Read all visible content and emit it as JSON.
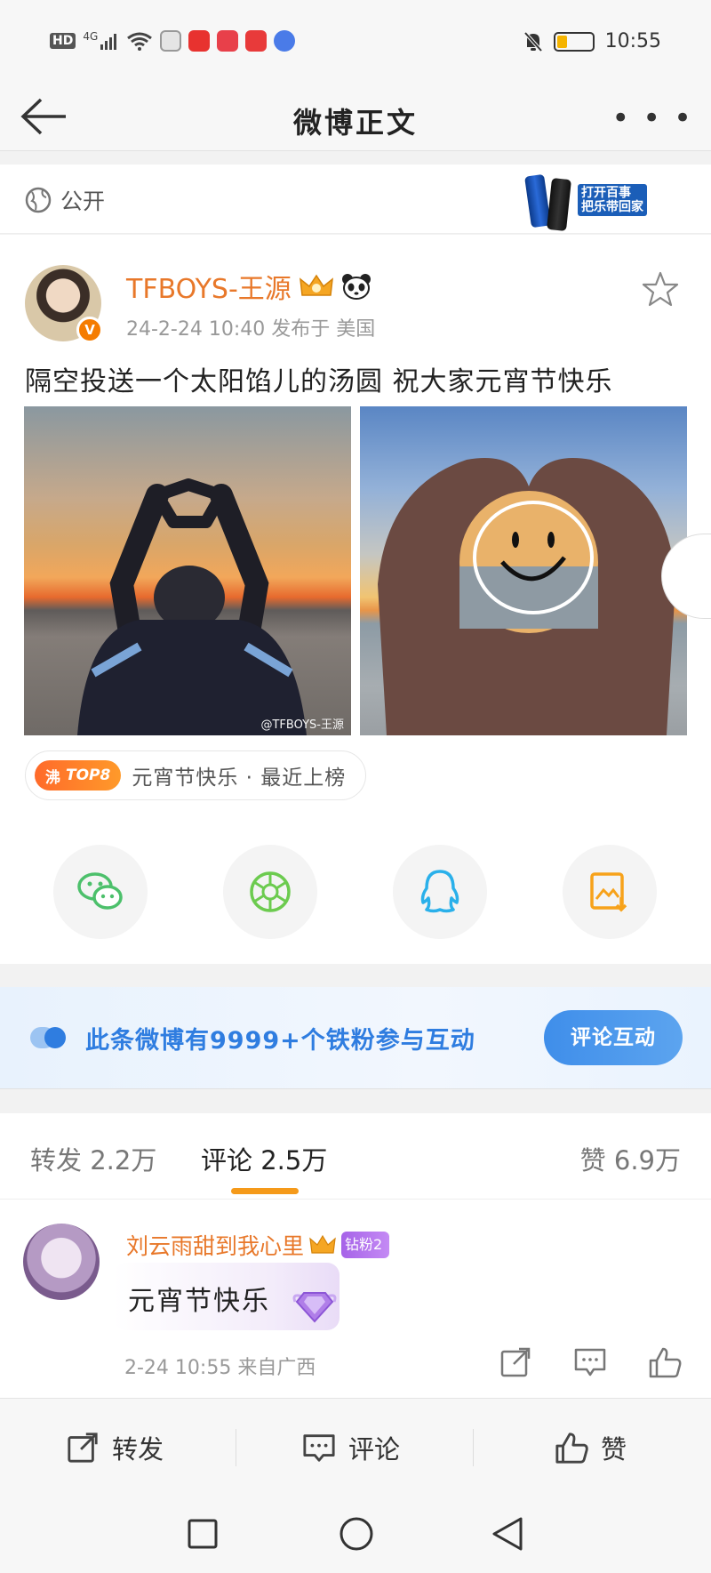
{
  "status_bar": {
    "time": "10:55",
    "network": "HD",
    "signal": "4G",
    "battery_percent": 30,
    "battery_color": "#f5b400"
  },
  "nav": {
    "title": "微博正文",
    "more_label": "• • •"
  },
  "visibility": {
    "label": "公开",
    "ad_text_line1": "打开百事",
    "ad_text_line2": "把乐带回家"
  },
  "post": {
    "username": "TFBOYS-王源",
    "meta": "24-2-24 10:40   发布于 美国",
    "text": "隔空投送一个太阳馅儿的汤圆 祝大家元宵节快乐",
    "watermark": "@TFBOYS-王源",
    "verified_mark": "V",
    "topic": {
      "badge": "沸",
      "rank": "TOP8",
      "text": "元宵节快乐 · 最近上榜"
    }
  },
  "share_buttons": [
    {
      "name": "wechat-icon",
      "color": "#4cc06b"
    },
    {
      "name": "moments-icon",
      "color": "#6ccb4f"
    },
    {
      "name": "qq-icon",
      "color": "#2ab0ea"
    },
    {
      "name": "save-image-icon",
      "color": "#f7a21a"
    }
  ],
  "fans_banner": {
    "text": "此条微博有9999+个铁粉参与互动",
    "button": "评论互动",
    "accent": "#2f7de0"
  },
  "tabs": {
    "repost": "转发 2.2万",
    "comment": "评论 2.5万",
    "like": "赞 6.9万",
    "active_color": "#f59a1a"
  },
  "comment": {
    "username": "刘云雨甜到我心里",
    "badge": "钻粉2",
    "text": "元宵节快乐",
    "meta": "2-24 10:55 来自广西"
  },
  "bottom_actions": {
    "repost": "转发",
    "comment": "评论",
    "like": "赞"
  },
  "username_color": "#e8782a"
}
